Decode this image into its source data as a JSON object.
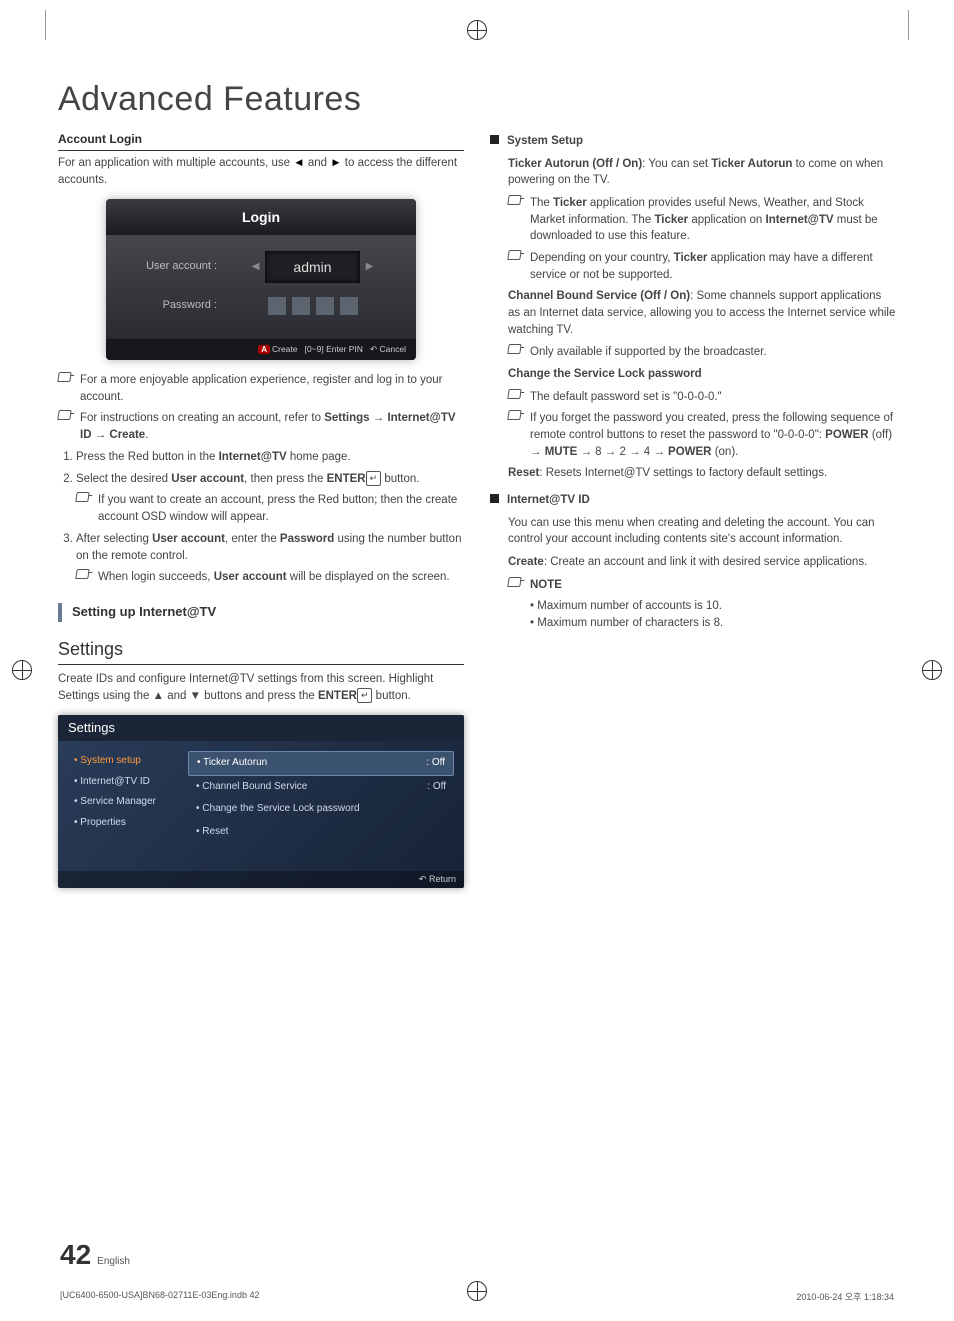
{
  "page_title": "Advanced Features",
  "left": {
    "account_login_heading": "Account Login",
    "account_login_intro_a": "For an application with multiple accounts, use ",
    "account_login_intro_b": " and ",
    "account_login_intro_c": " to access the different accounts.",
    "login_box": {
      "title": "Login",
      "user_account_label": "User account :",
      "user_account_value": "admin",
      "password_label": "Password :",
      "legend_create": "Create",
      "legend_pin": "[0~9] Enter PIN",
      "legend_cancel": "Cancel",
      "legend_a": "A"
    },
    "note1": "For a more enjoyable application experience, register and log in to your account.",
    "note2_a": "For instructions on creating an account, refer to ",
    "note2_b": "Settings → Internet@TV ID → Create",
    "steps": [
      {
        "n": "1.",
        "t_a": "Press the Red button in the ",
        "t_b": "Internet@TV",
        "t_c": " home page."
      },
      {
        "n": "2.",
        "t_a": "Select the desired ",
        "t_b": "User account",
        "t_c": ", then press the ",
        "t_d": "ENTER",
        "t_e": " button."
      },
      {
        "sub": "If you want to create an account, press the Red button; then the create account OSD window will appear."
      },
      {
        "n": "3.",
        "t_a": "After selecting ",
        "t_b": "User account",
        "t_c": ", enter the ",
        "t_d": "Password",
        "t_e": " using the number button on the remote control."
      },
      {
        "sub2_a": "When login succeeds, ",
        "sub2_b": "User account",
        "sub2_c": " will be displayed on the screen."
      }
    ],
    "subheading": "Setting up Internet@TV",
    "settings_h": "Settings",
    "settings_desc_a": "Create IDs and configure Internet@TV settings from this screen. Highlight Settings using the  ▲ and ▼ buttons and press the ",
    "settings_desc_b": "ENTER",
    "settings_desc_c": " button.",
    "settings_box": {
      "title": "Settings",
      "side": [
        "• System setup",
        "• Internet@TV ID",
        "• Service Manager",
        "• Properties"
      ],
      "items": [
        {
          "label": "• Ticker Autorun",
          "val": ": Off"
        },
        {
          "label": "• Channel Bound Service",
          "val": ": Off"
        },
        {
          "label": "• Change the Service Lock password",
          "val": ""
        },
        {
          "label": "• Reset",
          "val": ""
        }
      ],
      "return": "Return"
    }
  },
  "right": {
    "system_setup_h": "System Setup",
    "ticker_a": "Ticker Autorun (Off / On)",
    "ticker_b": ": You can set ",
    "ticker_c": "Ticker Autorun",
    "ticker_d": " to come on when powering on the TV.",
    "ticker_note1_a": "The ",
    "ticker_note1_b": "Ticker",
    "ticker_note1_c": " application provides useful News, Weather, and Stock Market information. The ",
    "ticker_note1_d": "Ticker",
    "ticker_note1_e": " application on ",
    "ticker_note1_f": "Internet@TV",
    "ticker_note1_g": " must be downloaded to use this feature.",
    "ticker_note2_a": "Depending on your country, ",
    "ticker_note2_b": "Ticker",
    "ticker_note2_c": " application may have a different service or not be supported.",
    "cbs_a": "Channel Bound Service (Off / On)",
    "cbs_b": ": Some channels support applications as an Internet data service, allowing you to access the Internet service while watching TV.",
    "cbs_note": "Only available if supported by the broadcaster.",
    "change_pw_h": "Change the Service Lock password",
    "change_pw_note1": "The default password set is \"0-0-0-0.\"",
    "change_pw_note2_a": "If you forget the password you created, press the following sequence of remote control buttons to reset the password to \"0-0-0-0\": ",
    "change_pw_note2_b": "POWER",
    "change_pw_note2_c": " (off) → ",
    "change_pw_note2_d": "MUTE",
    "change_pw_note2_e": " → 8 → 2 → 4 → ",
    "change_pw_note2_f": "POWER",
    "change_pw_note2_g": " (on).",
    "reset_a": "Reset",
    "reset_b": ": Resets Internet@TV settings to factory default settings.",
    "internet_id_h": "Internet@TV ID",
    "internet_id_desc": "You can use this menu when creating and deleting the account. You can control your account including contents site's account information.",
    "create_a": "Create",
    "create_b": ": Create an account and link it with desired service applications.",
    "note_h": "NOTE",
    "bullets": [
      "Maximum number of accounts is 10.",
      "Maximum number of characters is 8."
    ]
  },
  "footer": {
    "page": "42",
    "lang": "English"
  },
  "print_meta": {
    "left": "[UC6400-6500-USA]BN68-02711E-03Eng.indb   42",
    "right": "2010-06-24   오후 1:18:34"
  }
}
